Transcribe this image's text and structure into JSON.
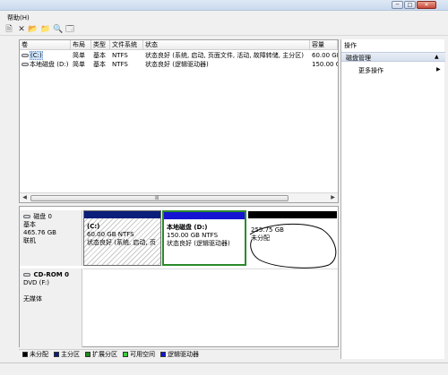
{
  "window": {
    "minimize_label": "─",
    "maximize_label": "□",
    "close_label": "✕"
  },
  "menu": {
    "help": "帮助(H)"
  },
  "toolbar": {
    "icons": [
      "document-icon",
      "delete-icon",
      "open-folder-icon",
      "folder-up-icon",
      "search-icon",
      "properties-icon"
    ],
    "glyphs": [
      "🗎",
      "✕",
      "📂",
      "📁",
      "🔍",
      "🗔"
    ]
  },
  "volume_table": {
    "columns": [
      "卷",
      "布局",
      "类型",
      "文件系统",
      "状态",
      "容量"
    ],
    "rows": [
      {
        "volume": "(C:)",
        "layout": "简单",
        "type": "基本",
        "fs": "NTFS",
        "status": "状态良好 (系统, 启动, 页面文件, 活动, 故障转储, 主分区)",
        "capacity": "60.00 GE"
      },
      {
        "volume": "本地磁盘 (D:)",
        "layout": "简单",
        "type": "基本",
        "fs": "NTFS",
        "status": "状态良好 (逻辑驱动器)",
        "capacity": "150.00 G"
      }
    ],
    "scroll_grip": "Ⅲ",
    "scroll_left": "◀",
    "scroll_right": "▶"
  },
  "disks": [
    {
      "name": "磁盘 0",
      "type": "基本",
      "size": "465.76 GB",
      "state": "联机",
      "partitions": [
        {
          "name": "(C:)",
          "size_fs": "60.00 GB NTFS",
          "status": "状态良好 (系统, 启动, 页",
          "color": "#0a1e7a"
        },
        {
          "name": "本地磁盘 (D:)",
          "size_fs": "150.00 GB NTFS",
          "status": "状态良好 (逻辑驱动器)",
          "color": "#1414d2"
        },
        {
          "name": "",
          "size_fs": "255.75 GB",
          "status": "未分配",
          "color": "#000000"
        }
      ]
    },
    {
      "name": "CD-ROM 0",
      "type": "DVD (F:)",
      "size": "",
      "state": "无媒体"
    }
  ],
  "legend": [
    {
      "label": "未分配",
      "color": "#000000"
    },
    {
      "label": "主分区",
      "color": "#0a1e7a"
    },
    {
      "label": "扩展分区",
      "color": "#1e8c1e"
    },
    {
      "label": "可用空间",
      "color": "#3ccd3c"
    },
    {
      "label": "逻辑驱动器",
      "color": "#1414d2"
    }
  ],
  "actions": {
    "title": "操作",
    "section": "磁盘管理",
    "section_arrow": "▲",
    "more": "更多操作",
    "more_arrow": "▶"
  }
}
